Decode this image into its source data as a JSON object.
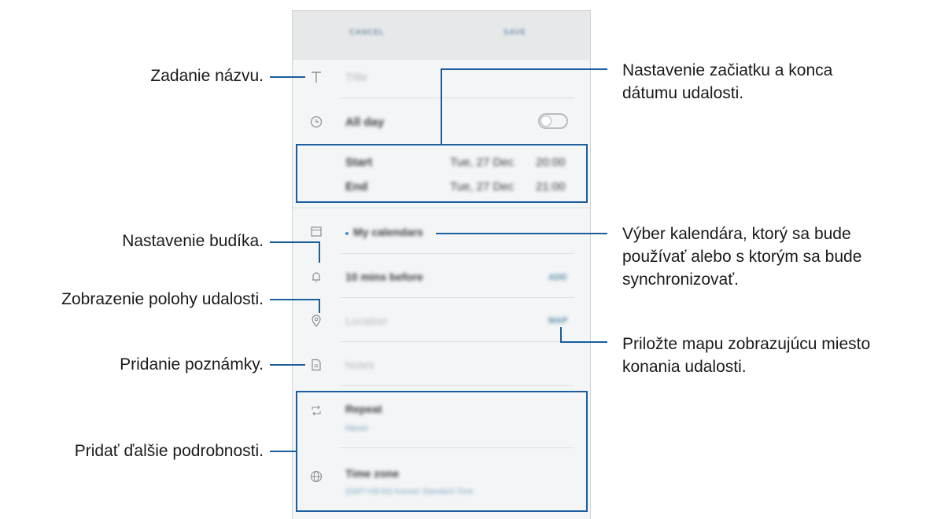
{
  "phone": {
    "header": {
      "cancel_label": "CANCEL",
      "save_label": "SAVE"
    },
    "title_placeholder": "Title",
    "all_day_label": "All day",
    "start_label": "Start",
    "start_date": "Tue, 27 Dec",
    "start_time": "20:00",
    "end_label": "End",
    "end_date": "Tue, 27 Dec",
    "end_time": "21:00",
    "calendar_label": "My calendars",
    "alarm_label": "10 mins before",
    "alarm_action": "ADD",
    "location_placeholder": "Location",
    "location_action": "MAP",
    "notes_placeholder": "Notes",
    "repeat_label": "Repeat",
    "repeat_value": "Never",
    "timezone_label": "Time zone",
    "timezone_value": "(GMT+09:00) Korean Standard Time"
  },
  "callouts": {
    "title": "Zadanie názvu.",
    "dates_line1": "Nastavenie začiatku a konca",
    "dates_line2": "dátumu udalosti.",
    "alarm": "Nastavenie budíka.",
    "calendar_line1": "Výber kalendára, ktorý sa bude",
    "calendar_line2": "používať alebo s ktorým sa bude",
    "calendar_line3": "synchronizovať.",
    "location": "Zobrazenie polohy udalosti.",
    "map_line1": "Priložte mapu zobrazujúcu miesto",
    "map_line2": "konania udalosti.",
    "notes": "Pridanie poznámky.",
    "more": "Pridať ďalšie podrobnosti."
  },
  "colors": {
    "accent": "#1a5e9c",
    "header": "#e6e8e9",
    "screen": "#f3f5f6"
  }
}
